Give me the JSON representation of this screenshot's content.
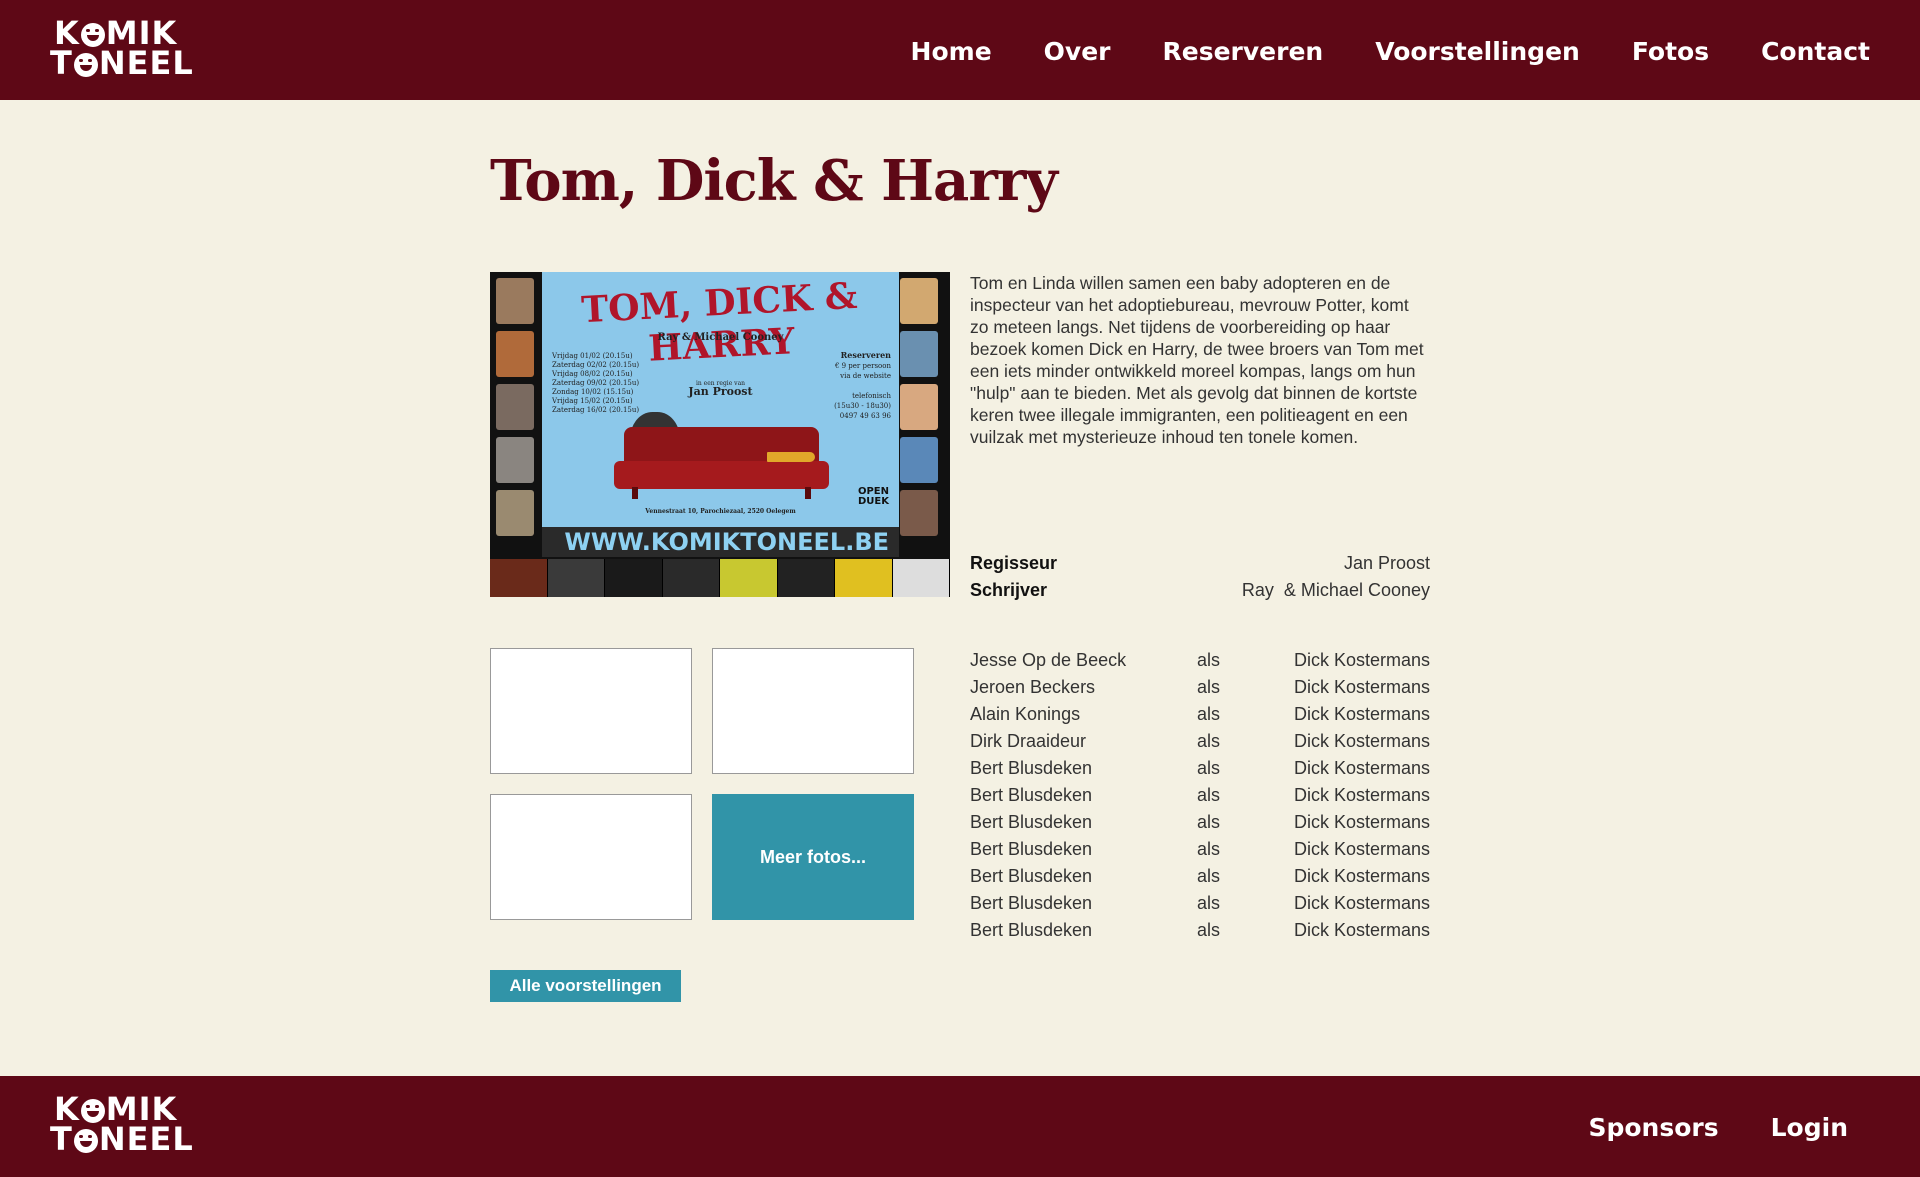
{
  "header": {
    "logo_line1_a": "K",
    "logo_line1_b": "MIK",
    "logo_line2_a": "T",
    "logo_line2_b": "NEEL",
    "nav": [
      "Home",
      "Over",
      "Reserveren",
      "Voorstellingen",
      "Fotos",
      "Contact"
    ]
  },
  "page": {
    "title": "Tom, Dick & Harry",
    "description": "Tom en Linda willen samen een baby adopteren en de inspecteur van het adoptiebureau, mevrouw Potter, komt zo meteen langs. Net tijdens de voorbereiding op haar bezoek komen Dick en Harry, de twee broers van Tom met een iets minder ontwikkeld moreel kompas, langs om hun \"hulp\" aan te bieden. Met als gevolg dat binnen de kortste keren twee illegale immigranten, een politieagent en een vuilzak met mysterieuze inhoud ten tonele komen.",
    "credits": [
      {
        "label": "Regisseur",
        "value": "Jan Proost"
      },
      {
        "label": "Schrijver",
        "value": "Ray  & Michael Cooney"
      }
    ],
    "cast": [
      {
        "actor": "Jesse Op de Beeck",
        "als": "als",
        "role": "Dick Kostermans"
      },
      {
        "actor": "Jeroen Beckers",
        "als": "als",
        "role": "Dick Kostermans"
      },
      {
        "actor": "Alain Konings",
        "als": "als",
        "role": "Dick Kostermans"
      },
      {
        "actor": "Dirk Draaideur",
        "als": "als",
        "role": "Dick Kostermans"
      },
      {
        "actor": "Bert Blusdeken",
        "als": "als",
        "role": "Dick Kostermans"
      },
      {
        "actor": "Bert Blusdeken",
        "als": "als",
        "role": "Dick Kostermans"
      },
      {
        "actor": "Bert Blusdeken",
        "als": "als",
        "role": "Dick Kostermans"
      },
      {
        "actor": "Bert Blusdeken",
        "als": "als",
        "role": "Dick Kostermans"
      },
      {
        "actor": "Bert Blusdeken",
        "als": "als",
        "role": "Dick Kostermans"
      },
      {
        "actor": "Bert Blusdeken",
        "als": "als",
        "role": "Dick Kostermans"
      },
      {
        "actor": "Bert Blusdeken",
        "als": "als",
        "role": "Dick Kostermans"
      }
    ],
    "more_photos": "Meer fotos...",
    "all_shows": "Alle voorstellingen"
  },
  "poster": {
    "title": "TOM, DICK & HARRY",
    "authors": "Ray & Michael Cooney",
    "dates": [
      "Vrijdag    01/02  (20.15u)",
      "Zaterdag  02/02  (20.15u)",
      "Vrijdag    08/02  (20.15u)",
      "Zaterdag  09/02  (20.15u)",
      "Zondag    10/02  (15.15u)",
      "Vrijdag    15/02  (20.15u)",
      "Zaterdag  16/02  (20.15u)"
    ],
    "reserve_title": "Reserveren",
    "reserve_lines": [
      "€ 9 per persoon",
      "via de website",
      "",
      "telefonisch",
      "(15u30 - 18u30)",
      "0497 49 63 96"
    ],
    "director_intro": "in een regie van",
    "director": "Jan Proost",
    "address": "Vennestraat 10, Parochiezaal, 2520 Oelegem",
    "venue_a": "OPEN",
    "venue_b": "DUEK",
    "url": "WWW.KOMIKTONEEL.BE"
  },
  "footer": {
    "nav": [
      "Sponsors",
      "Login"
    ]
  },
  "colors": {
    "brand": "#5e0816",
    "accent": "#3194a8",
    "background": "#f4f1e3"
  }
}
